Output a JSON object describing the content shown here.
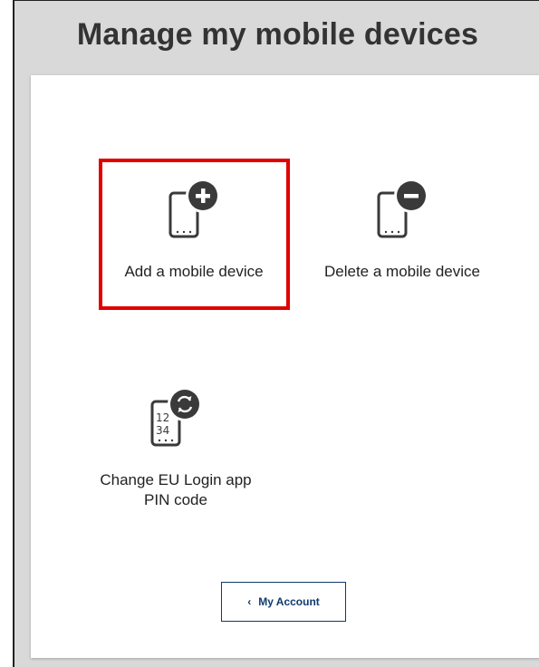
{
  "page": {
    "title": "Manage my mobile devices"
  },
  "tiles": [
    {
      "label": "Add a mobile device",
      "icon": "mobile-add-icon"
    },
    {
      "label": "Delete a mobile device",
      "icon": "mobile-delete-icon"
    },
    {
      "label_line1": "Change EU Login app",
      "label_line2": "PIN code",
      "icon": "mobile-pin-change-icon"
    }
  ],
  "back_button": {
    "label": "My Account",
    "icon": "chevron-left-icon"
  },
  "colors": {
    "background": "#d9d9d9",
    "panel": "#ffffff",
    "highlight": "#e00000",
    "button_border": "#0e3a6e",
    "icon_dark": "#3a3a3a"
  }
}
